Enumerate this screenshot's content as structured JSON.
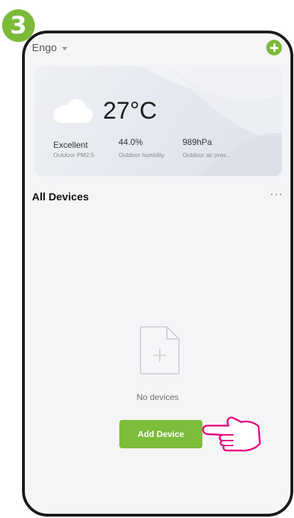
{
  "step": {
    "number": "3"
  },
  "header": {
    "home_name": "Engo",
    "add_icon": "plus-circle-icon"
  },
  "weather": {
    "icon": "cloud-icon",
    "temperature": "27°C",
    "stats": [
      {
        "value": "Excellent",
        "label": "Outdoor PM2.5"
      },
      {
        "value": "44.0%",
        "label": "Outdoor humidity"
      },
      {
        "value": "989hPa",
        "label": "Outdoor air pres..."
      }
    ]
  },
  "devices": {
    "title": "All Devices",
    "more_label": "···",
    "empty_text": "No devices",
    "add_button_label": "Add Device"
  },
  "colors": {
    "accent": "#7cba3a",
    "hand_outline": "#e6007e",
    "frame": "#1a1a1a"
  }
}
